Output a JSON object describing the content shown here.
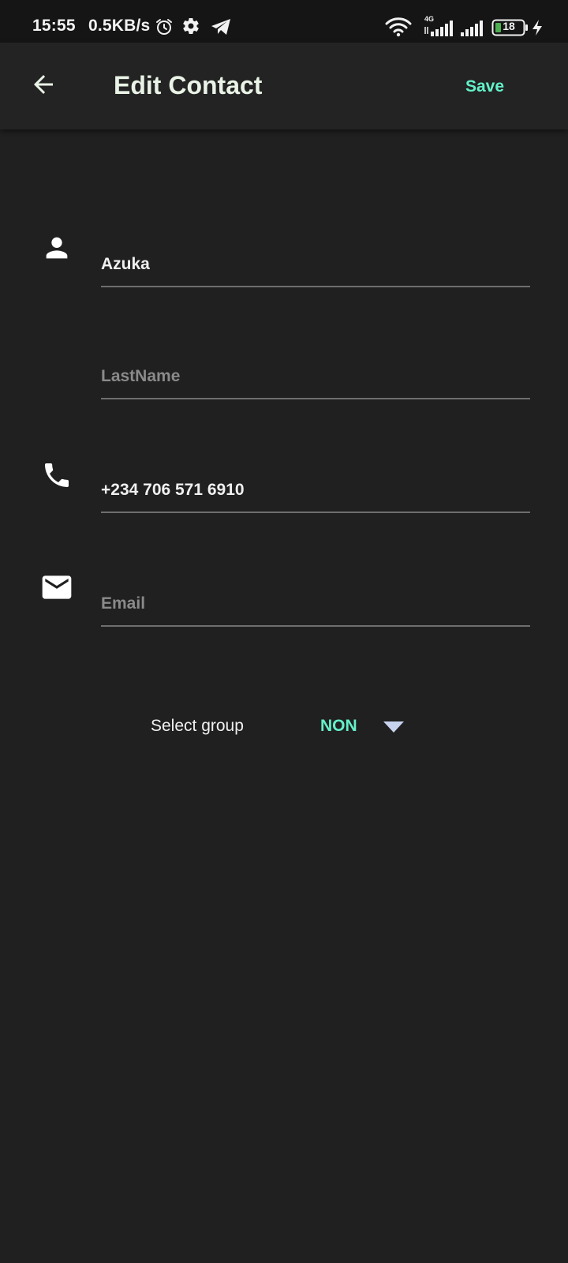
{
  "status_bar": {
    "time": "15:55",
    "speed": "0.5KB/s",
    "network_type": "4G",
    "battery_level": "18",
    "icons": [
      "alarm-icon",
      "settings-icon",
      "telegram-icon",
      "wifi-icon",
      "signal-icon",
      "battery-icon",
      "charging-icon"
    ]
  },
  "app_bar": {
    "title": "Edit Contact",
    "save_label": "Save",
    "back_icon": "arrow-back-icon"
  },
  "form": {
    "first_name": {
      "value": "Azuka",
      "placeholder": "",
      "icon": "person-icon"
    },
    "last_name": {
      "value": "",
      "placeholder": "LastName"
    },
    "phone": {
      "value": "+234 706 571 6910",
      "placeholder": "",
      "icon": "phone-icon"
    },
    "email": {
      "value": "",
      "placeholder": "Email",
      "icon": "mail-icon"
    }
  },
  "group": {
    "label": "Select group",
    "selected": "NON",
    "icon": "dropdown-arrow-icon"
  },
  "colors": {
    "accent": "#64f0c8",
    "background": "#202020",
    "app_bar": "#232323",
    "status_bar": "#151515"
  }
}
